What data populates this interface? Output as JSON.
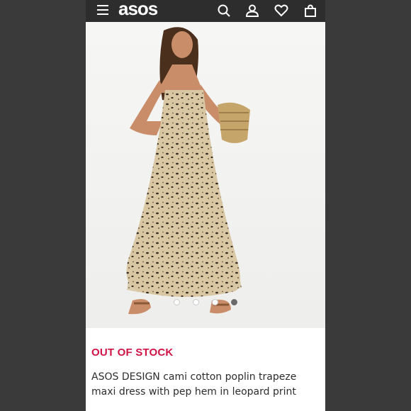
{
  "header": {
    "logo": "asos",
    "icons": [
      "menu-icon",
      "search-icon",
      "account-icon",
      "wishlist-icon",
      "bag-icon"
    ]
  },
  "carousel": {
    "count": 4,
    "active_index": 4
  },
  "product": {
    "status": "OUT OF STOCK",
    "name": "ASOS DESIGN cami cotton poplin trapeze maxi dress with pep hem in leopard print"
  },
  "colors": {
    "status": "#d01345",
    "header": "#2d2d2d"
  }
}
